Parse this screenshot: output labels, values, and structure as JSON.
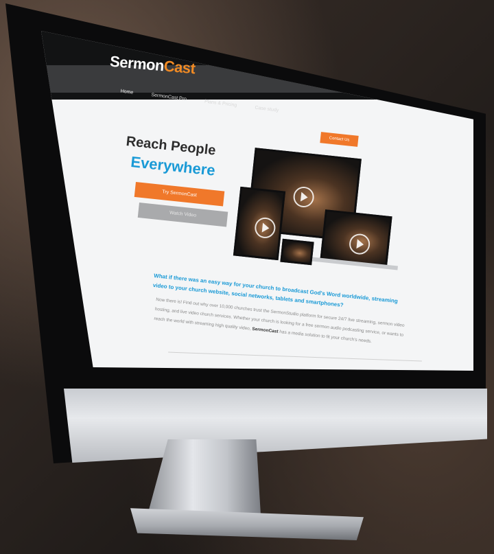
{
  "site": {
    "logo_text": "Sermon",
    "logo_accent": "Cast",
    "nav": [
      "Home",
      "SermonCast Pro",
      "Plans & Pricing",
      "Case study"
    ],
    "cta": "Contact Us"
  },
  "hero": {
    "headline_line1": "Reach People",
    "headline_line2": "Everywhere",
    "btn_primary": "Try SermonCast",
    "btn_secondary": "Watch Video"
  },
  "intro": {
    "question": "What if there was an easy way for your church to broadcast God's Word worldwide, streaming video to your church website, social networks, tablets and smartphones?",
    "body": "Now there is! Find out why over 10,000 churches trust the SermonStudio platform for secure 24/7 live streaming, sermon video hosting, and live video church services. Whether your church is looking for a free sermon audio podcasting service, or wants to reach the world with streaming high quality video,",
    "brand_bold": "SermonCast",
    "closing": "has a media solution to fit your church's needs."
  },
  "colors": {
    "accent_orange": "#f0782a",
    "accent_blue": "#1a9ad6"
  }
}
